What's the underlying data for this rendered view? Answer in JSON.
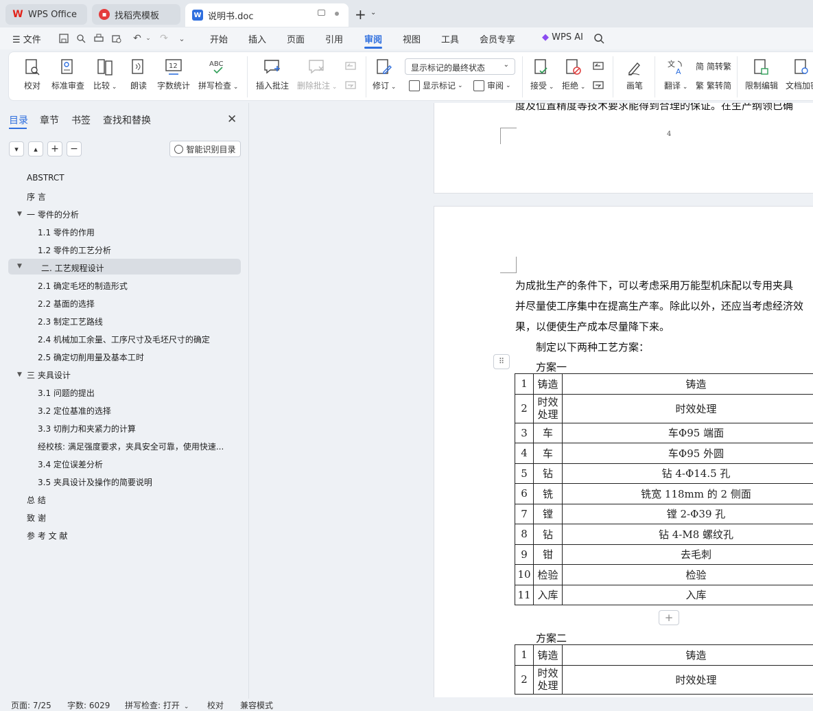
{
  "tabs": [
    {
      "label": "WPS Office",
      "icon": "wps-logo-icon"
    },
    {
      "label": "找稻壳模板",
      "icon": "daoke-icon"
    },
    {
      "label": "说明书.doc",
      "icon": "word-doc-icon"
    }
  ],
  "menu": {
    "file": "文件",
    "items": [
      "开始",
      "插入",
      "页面",
      "引用",
      "审阅",
      "视图",
      "工具",
      "会员专享"
    ],
    "active": "审阅",
    "ai": "WPS AI"
  },
  "ribbon": {
    "proofread": "校对",
    "std_review": "标准审查",
    "compare": "比较",
    "read_aloud": "朗读",
    "word_count": "字数统计",
    "spell_check": "拼写检查",
    "insert_comment": "插入批注",
    "delete_comment": "删除批注",
    "revise": "修订",
    "display_state": "显示标记的最终状态",
    "show_marks": "显示标记",
    "review": "审阅",
    "accept": "接受",
    "reject": "拒绝",
    "pen": "画笔",
    "translate": "翻译",
    "trad_simp": "简转繁",
    "simp_trad": "繁转简",
    "restrict_edit": "限制编辑",
    "doc_encrypt": "文档加密"
  },
  "sidebar": {
    "tabs": [
      "目录",
      "章节",
      "书签",
      "查找和替换"
    ],
    "smart_btn": "智能识别目录",
    "toc": [
      {
        "text": "ABSTRCT",
        "level": 1
      },
      {
        "text": "序    言",
        "level": 1
      },
      {
        "text": "一  零件的分析",
        "level": 1,
        "expand": true
      },
      {
        "text": "1.1 零件的作用",
        "level": 2
      },
      {
        "text": "1.2 零件的工艺分析",
        "level": 2
      },
      {
        "text": "二. 工艺规程设计",
        "level": 1,
        "expand": true,
        "selected": true
      },
      {
        "text": "2.1 确定毛坯的制造形式",
        "level": 2
      },
      {
        "text": "2.2 基面的选择",
        "level": 2
      },
      {
        "text": "2.3 制定工艺路线",
        "level": 2
      },
      {
        "text": "2.4 机械加工余量、工序尺寸及毛坯尺寸的确定",
        "level": 2
      },
      {
        "text": "2.5  确定切削用量及基本工时",
        "level": 2
      },
      {
        "text": "三  夹具设计",
        "level": 1,
        "expand": true
      },
      {
        "text": "3.1 问题的提出",
        "level": 2
      },
      {
        "text": "3.2 定位基准的选择",
        "level": 2
      },
      {
        "text": "3.3 切削力和夹紧力的计算",
        "level": 2
      },
      {
        "text": "经校核:   满足强度要求，夹具安全可靠，使用快速...",
        "level": 2
      },
      {
        "text": "3.4 定位误差分析",
        "level": 2
      },
      {
        "text": "3.5 夹具设计及操作的简要说明",
        "level": 2
      },
      {
        "text": "总      结",
        "level": 1
      },
      {
        "text": "致    谢",
        "level": 1
      },
      {
        "text": "参 考 文 献",
        "level": 1
      }
    ]
  },
  "document": {
    "page_number": "4",
    "top_cut_text": "度及位置精度等技术要求能得到合理的保证。在生产纲领已确",
    "para_lines": [
      "为成批生产的条件下，可以考虑采用万能型机床配以专用夹具",
      "并尽量使工序集中在提高生产率。除此以外，还应当考虑经济效",
      "果，以便使生产成本尽量降下来。"
    ],
    "plan_intro": "制定以下两种工艺方案：",
    "plan1_title": "方案一",
    "plan1_rows": [
      [
        "1",
        "铸造",
        "铸造"
      ],
      [
        "2",
        "时效处理",
        "时效处理"
      ],
      [
        "3",
        "车",
        "车Φ95 端面"
      ],
      [
        "4",
        "车",
        "车Φ95 外圆"
      ],
      [
        "5",
        "钻",
        "钻 4-Φ14.5 孔"
      ],
      [
        "6",
        "铣",
        "铣宽 118mm 的 2 侧面"
      ],
      [
        "7",
        "镗",
        "镗 2-Φ39 孔"
      ],
      [
        "8",
        "钻",
        "钻 4-M8 螺纹孔"
      ],
      [
        "9",
        "钳",
        "去毛刺"
      ],
      [
        "10",
        "检验",
        "检验"
      ],
      [
        "11",
        "入库",
        "入库"
      ]
    ],
    "add_row": "+",
    "plan2_title": "方案二",
    "plan2_rows": [
      [
        "1",
        "铸造",
        "铸造"
      ],
      [
        "2",
        "时效处理",
        "时效处理"
      ]
    ]
  },
  "status": {
    "page": "页面: 7/25",
    "words": "字数: 6029",
    "spell": "拼写检查: 打开",
    "proof": "校对",
    "compat": "兼容模式"
  }
}
